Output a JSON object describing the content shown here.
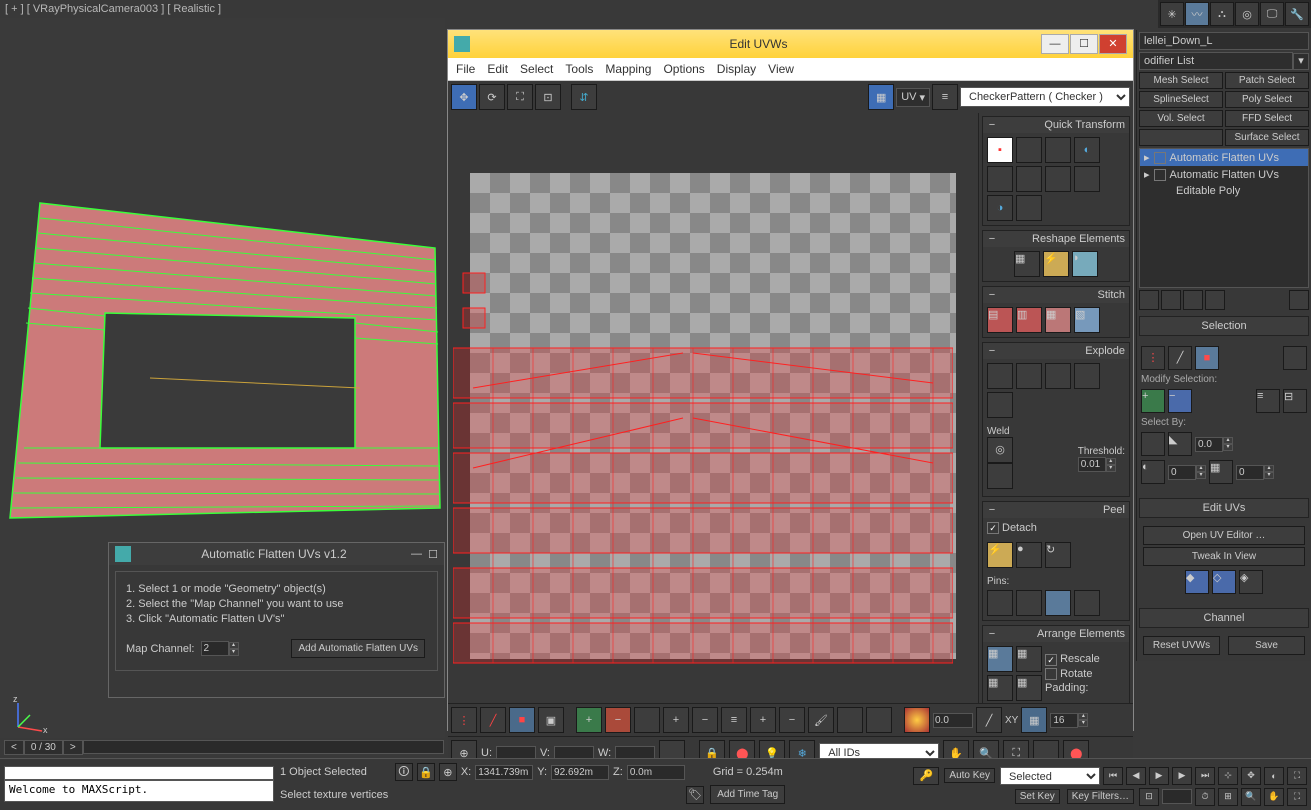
{
  "viewport": {
    "label": "[ + ] [ VRayPhysicalCamera003 ] [ Realistic ]"
  },
  "edit_uvws": {
    "title": "Edit UVWs",
    "menus": [
      "File",
      "Edit",
      "Select",
      "Tools",
      "Mapping",
      "Options",
      "Display",
      "View"
    ],
    "uv_label": "UV",
    "map_dd": "CheckerPattern  ( Checker )",
    "sections": {
      "quick_transform": "Quick Transform",
      "reshape": "Reshape Elements",
      "stitch": "Stitch",
      "explode": "Explode",
      "peel": "Peel",
      "arrange": "Arrange Elements"
    },
    "weld_label": "Weld",
    "threshold_label": "Threshold:",
    "threshold_value": "0.01",
    "detach_label": "Detach",
    "pins_label": "Pins:",
    "rescale_label": "Rescale",
    "rotate_label": "Rotate",
    "padding_label": "Padding:",
    "bottom_value": "0.0",
    "xy_label": "XY",
    "grid_val": "16",
    "coord_u": "U:",
    "coord_v": "V:",
    "coord_w": "W:",
    "all_ids": "All IDs"
  },
  "afu": {
    "title": "Automatic Flatten UVs v1.2",
    "step1": "1. Select 1 or mode \"Geometry\" object(s)",
    "step2": "2. Select the \"Map Channel\" you want to use",
    "step3": "3. Click \"Automatic Flatten UV's\"",
    "map_channel_label": "Map Channel:",
    "map_channel_value": "2",
    "add_btn": "Add Automatic Flatten UVs"
  },
  "command_panel": {
    "object_name": "lellei_Down_L",
    "modifier_list_label": "odifier List",
    "sel_sets": [
      [
        "Mesh Select",
        "Patch Select"
      ],
      [
        "SplineSelect",
        "Poly Select"
      ],
      [
        "Vol. Select",
        "FFD Select"
      ],
      [
        "",
        "Surface Select"
      ]
    ],
    "stack": [
      "Automatic Flatten UVs",
      "Automatic Flatten UVs",
      "Editable Poly"
    ],
    "selection_hdr": "Selection",
    "modify_sel": "Modify Selection:",
    "select_by": "Select By:",
    "sel_by_val1": "0.0",
    "sel_by_val2": "0",
    "sel_by_val3": "0",
    "edit_uvs_hdr": "Edit UVs",
    "open_editor": "Open UV Editor …",
    "tweak": "Tweak In View",
    "channel_hdr": "Channel",
    "reset": "Reset UVWs",
    "save": "Save"
  },
  "timeline": {
    "frame": "0 / 30"
  },
  "status": {
    "objects": "1 Object Selected",
    "prompt": "Select texture vertices",
    "x": "1341.739m",
    "y": "92.692m",
    "z": "0.0m",
    "grid": "Grid = 0.254m",
    "add_time_tag": "Add Time Tag",
    "auto_key": "Auto Key",
    "set_key": "Set Key",
    "selected": "Selected",
    "key_filters": "Key Filters…"
  },
  "maxscript": {
    "text": "Welcome to MAXScript."
  }
}
